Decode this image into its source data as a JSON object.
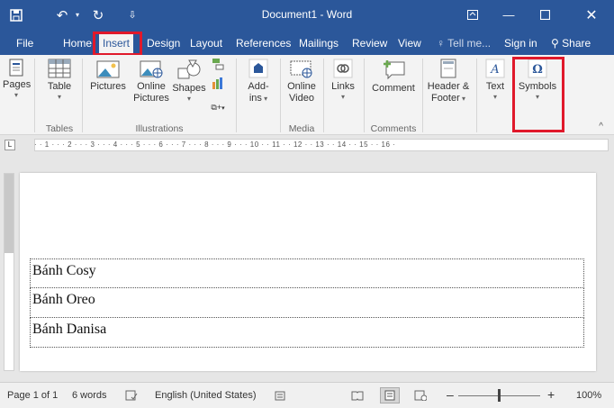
{
  "titlebar": {
    "save_icon": "save-icon",
    "undo_icon": "undo-icon",
    "redo_icon": "redo-icon",
    "qa_menu_icon": "dropdown-icon",
    "title": "Document1 - Word",
    "restore_ribbon_icon": "ribbon-display-options-icon"
  },
  "tabs": {
    "file": "File",
    "home": "Home",
    "insert": "Insert",
    "design": "Design",
    "layout": "Layout",
    "references": "References",
    "mailings": "Mailings",
    "review": "Review",
    "view": "View",
    "tell_me": "Tell me...",
    "sign_in": "Sign in",
    "share": "Share"
  },
  "ribbon": {
    "pages": "Pages",
    "table": "Table",
    "pictures": "Pictures",
    "online_pictures_1": "Online",
    "online_pictures_2": "Pictures",
    "shapes": "Shapes",
    "addins_1": "Add-",
    "addins_2": "ins",
    "online_video_1": "Online",
    "online_video_2": "Video",
    "links": "Links",
    "comment": "Comment",
    "header_footer_1": "Header &",
    "header_footer_2": "Footer",
    "text": "Text",
    "symbols": "Symbols",
    "groups": {
      "tables": "Tables",
      "illustrations": "Illustrations",
      "media": "Media",
      "comments": "Comments"
    }
  },
  "ruler": {
    "marks": "· · 1 · · · 2 · · · 3 · · · 4 · · · 5 · · · 6 · · · 7 · · · 8 · · · 9 · · · 10 · · 11 · · 12 · · 13 · · 14 · · 15 · · 16 ·"
  },
  "document": {
    "rows": [
      "Bánh Cosy",
      "Bánh Oreo",
      "Bánh Danisa"
    ]
  },
  "status": {
    "page": "Page 1 of 1",
    "words": "6 words",
    "language": "English (United States)",
    "zoom_minus": "–",
    "zoom_plus": "+",
    "zoom": "100%"
  },
  "colors": {
    "brand": "#2b579a",
    "highlight": "#e0192b"
  }
}
